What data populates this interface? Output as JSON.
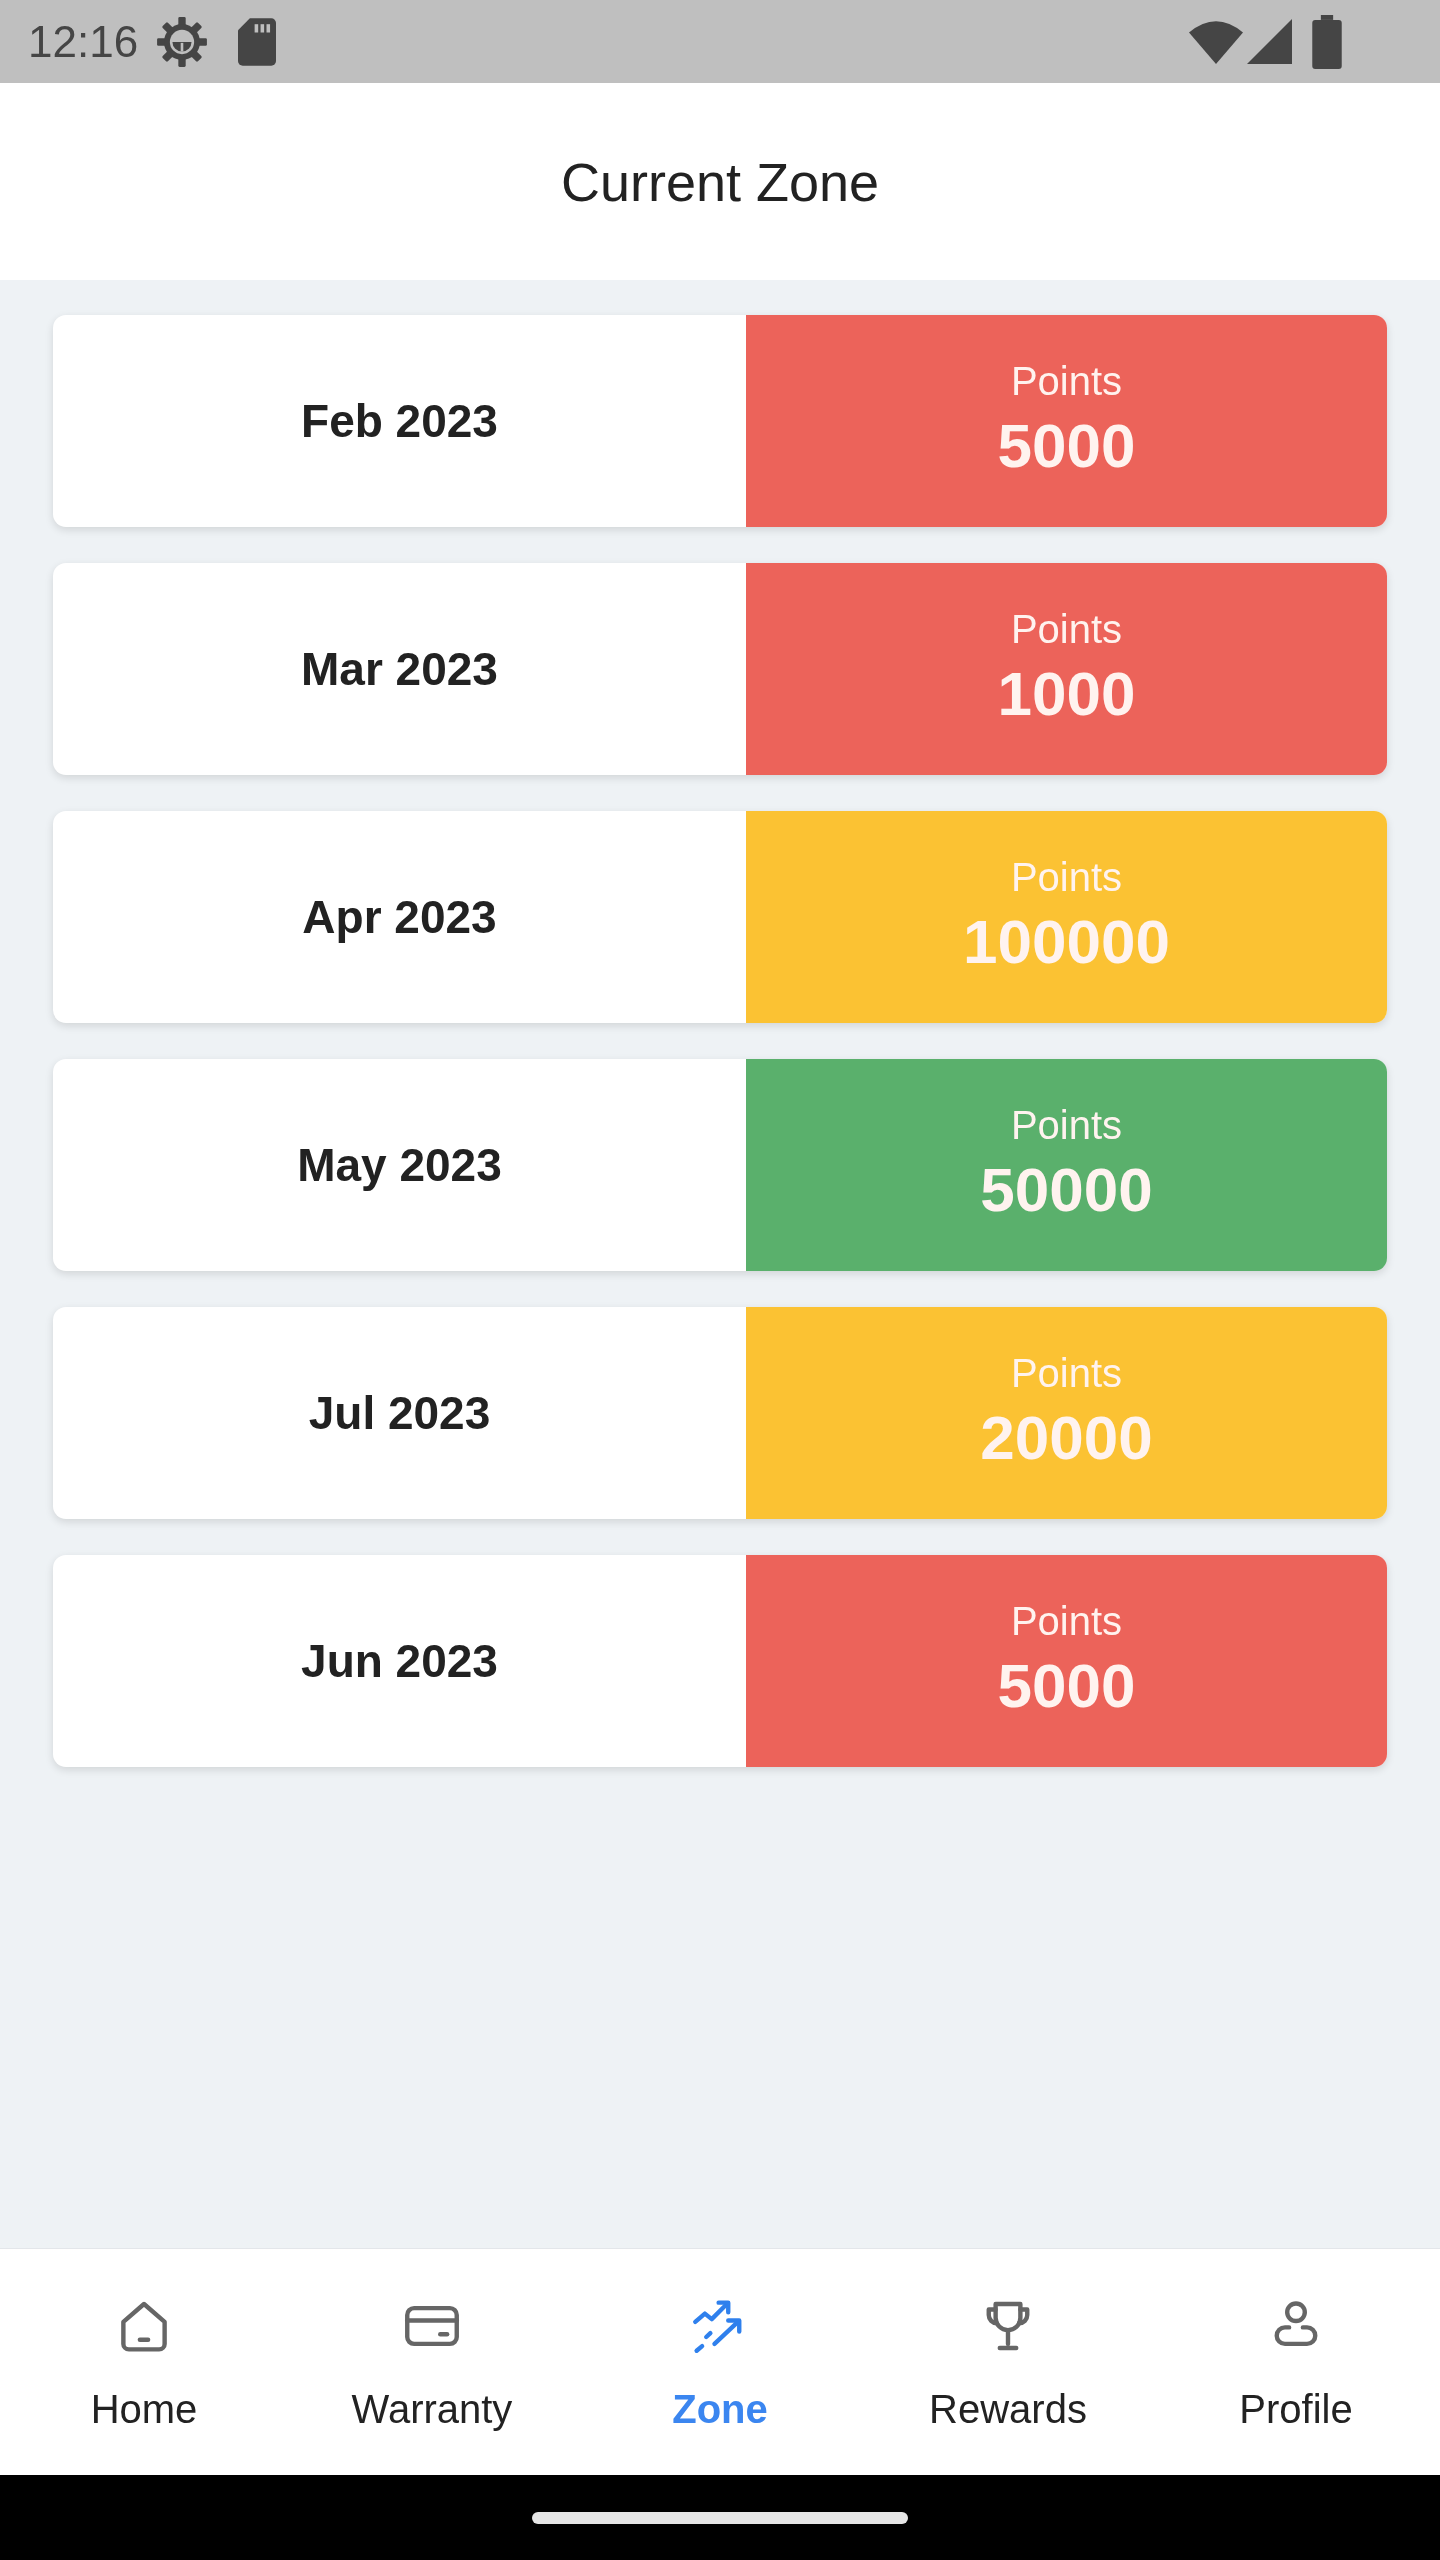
{
  "status_bar": {
    "time": "12:16"
  },
  "header": {
    "title": "Current Zone"
  },
  "zones": [
    {
      "month": "Feb 2023",
      "label": "Points",
      "points": "5000",
      "color": "#ec635a"
    },
    {
      "month": "Mar 2023",
      "label": "Points",
      "points": "1000",
      "color": "#ec635a"
    },
    {
      "month": "Apr 2023",
      "label": "Points",
      "points": "100000",
      "color": "#fbc233"
    },
    {
      "month": "May 2023",
      "label": "Points",
      "points": "50000",
      "color": "#5ab06c"
    },
    {
      "month": "Jul 2023",
      "label": "Points",
      "points": "20000",
      "color": "#fbc233"
    },
    {
      "month": "Jun 2023",
      "label": "Points",
      "points": "5000",
      "color": "#ec635a"
    }
  ],
  "bottom_nav": [
    {
      "label": "Home",
      "selected": false
    },
    {
      "label": "Warranty",
      "selected": false
    },
    {
      "label": "Zone",
      "selected": true
    },
    {
      "label": "Rewards",
      "selected": false
    },
    {
      "label": "Profile",
      "selected": false
    }
  ]
}
